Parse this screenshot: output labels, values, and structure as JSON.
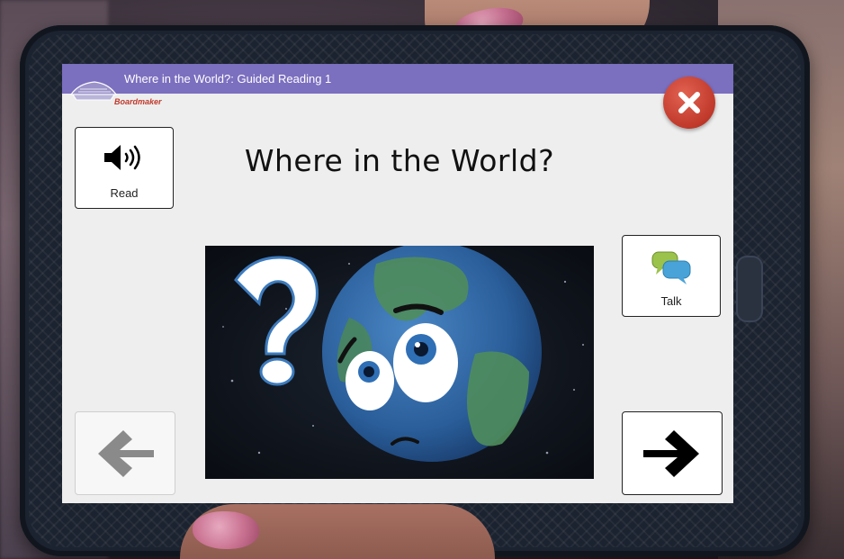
{
  "window": {
    "title": "Where in the World?: Guided Reading 1",
    "logo_text": "Boardmaker"
  },
  "page": {
    "heading": "Where in the World?"
  },
  "buttons": {
    "read_label": "Read",
    "talk_label": "Talk",
    "close_icon": "close-x-icon",
    "back_icon": "arrow-left-icon",
    "next_icon": "arrow-right-icon"
  },
  "picture": {
    "subject": "cartoon-earth-with-question-mark"
  },
  "colors": {
    "titlebar": "#7b6fbf",
    "close_button": "#c0392b",
    "screen_background": "#eeeeee",
    "back_arrow_disabled": "#8a8a8a",
    "next_arrow": "#000000"
  }
}
